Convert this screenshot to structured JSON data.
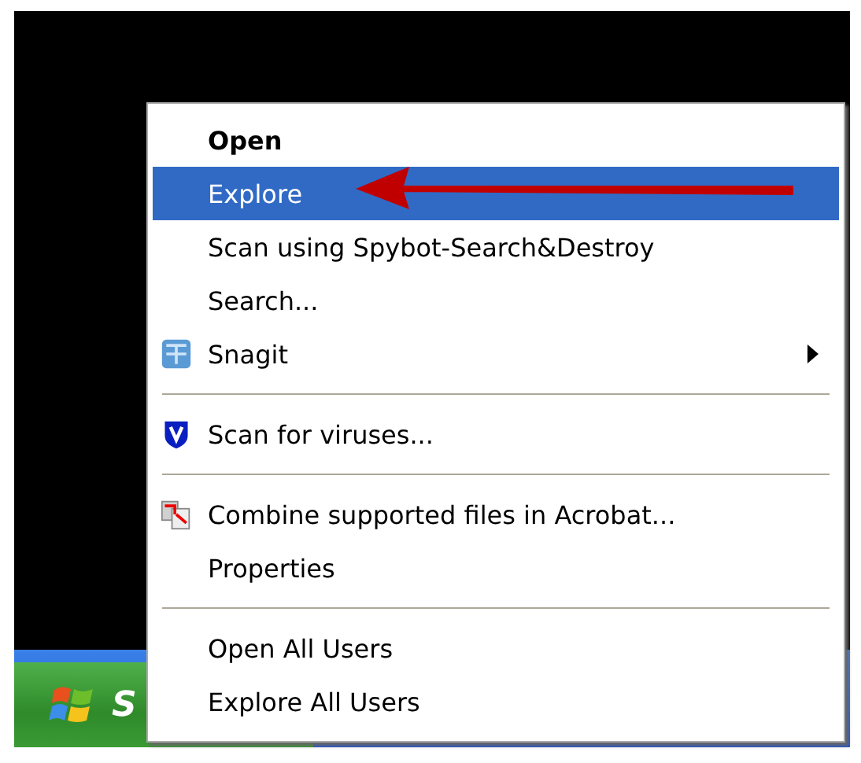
{
  "menu": {
    "items": [
      {
        "kind": "item",
        "label": "Open",
        "default": true,
        "selected": false
      },
      {
        "kind": "item",
        "label": "Explore",
        "default": false,
        "selected": true
      },
      {
        "kind": "item",
        "label": "Scan using Spybot-Search&Destroy",
        "default": false,
        "selected": false
      },
      {
        "kind": "item",
        "label": "Search...",
        "default": false,
        "selected": false
      },
      {
        "kind": "icon-item",
        "label": "Snagit",
        "default": false,
        "selected": false,
        "submenu": true
      },
      {
        "kind": "separator"
      },
      {
        "kind": "icon-item",
        "label": "Scan for viruses...",
        "default": false,
        "selected": false
      },
      {
        "kind": "separator"
      },
      {
        "kind": "icon-item",
        "label": "Combine supported files in Acrobat...",
        "default": false,
        "selected": false
      },
      {
        "kind": "item",
        "label": "Properties",
        "default": false,
        "selected": false
      },
      {
        "kind": "separator"
      },
      {
        "kind": "item",
        "label": "Open All Users",
        "default": false,
        "selected": false
      },
      {
        "kind": "item",
        "label": "Explore All Users",
        "default": false,
        "selected": false
      }
    ]
  },
  "taskbar": {
    "start_label": "S"
  }
}
